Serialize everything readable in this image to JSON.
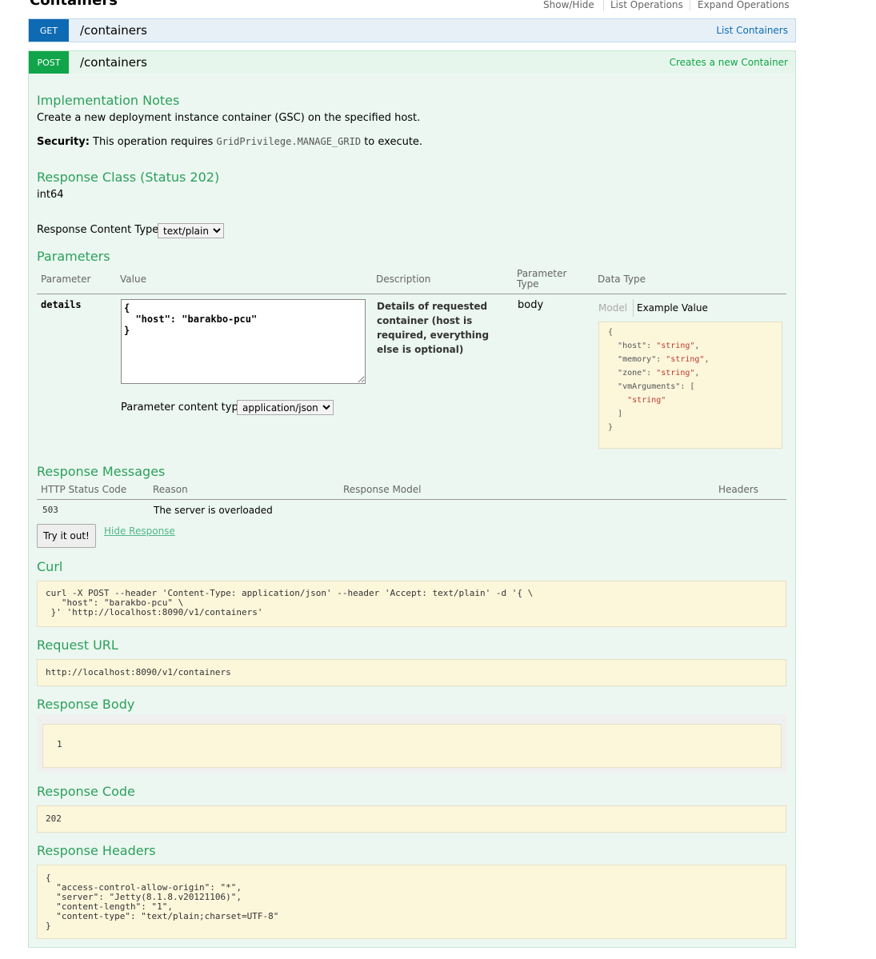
{
  "header": {
    "title": "Containers",
    "links": {
      "show_hide": "Show/Hide",
      "list_operations": "List Operations",
      "expand_operations": "Expand Operations"
    }
  },
  "get_endpoint": {
    "method": "GET",
    "path": "/containers",
    "summary": "List Containers"
  },
  "post_endpoint": {
    "method": "POST",
    "path": "/containers",
    "summary": "Creates a new Container"
  },
  "implementation_notes": {
    "heading": "Implementation Notes",
    "text": "Create a new deployment instance container (GSC) on the specified host.",
    "security_label": "Security:",
    "security_pre": "This operation requires",
    "security_code": "GridPrivilege.MANAGE_GRID",
    "security_post": "to execute."
  },
  "response_class": {
    "heading": "Response Class (Status 202)",
    "type": "int64"
  },
  "response_content_type": {
    "label": "Response Content Type",
    "selected": "text/plain"
  },
  "parameters": {
    "heading": "Parameters",
    "columns": {
      "parameter": "Parameter",
      "value": "Value",
      "description": "Description",
      "param_type_1": "Parameter",
      "param_type_2": "Type",
      "data_type": "Data Type"
    },
    "row": {
      "name": "details",
      "value": "{\n  \"host\": \"barakbo-pcu\"\n}",
      "description": "Details of requested container (host is required, everything else is optional)",
      "type": "body",
      "content_type_label": "Parameter content type:",
      "content_type_selected": "application/json",
      "model_tab": "Model",
      "example_tab": "Example Value",
      "example": {
        "open": "{",
        "host_key": "\"host\": ",
        "memory_key": "\"memory\": ",
        "zone_key": "\"zone\": ",
        "vm_key": "\"vmArguments\": [",
        "string_val": "\"string\"",
        "comma": ",",
        "close_arr": "]",
        "close": "}"
      }
    }
  },
  "response_messages": {
    "heading": "Response Messages",
    "columns": {
      "code": "HTTP Status Code",
      "reason": "Reason",
      "model": "Response Model",
      "headers": "Headers"
    },
    "row": {
      "code": "503",
      "reason": "The server is overloaded"
    }
  },
  "actions": {
    "try": "Try it out!",
    "hide": "Hide Response"
  },
  "curl": {
    "heading": "Curl",
    "text": "curl -X POST --header 'Content-Type: application/json' --header 'Accept: text/plain' -d '{ \\\n   \"host\": \"barakbo-pcu\" \\\n }' 'http://localhost:8090/v1/containers'"
  },
  "request_url": {
    "heading": "Request URL",
    "value": "http://localhost:8090/v1/containers"
  },
  "response_body": {
    "heading": "Response Body",
    "value": "1"
  },
  "response_code": {
    "heading": "Response Code",
    "value": "202"
  },
  "response_headers": {
    "heading": "Response Headers",
    "text": "{\n  \"access-control-allow-origin\": \"*\",\n  \"server\": \"Jetty(8.1.8.v20121106)\",\n  \"content-length\": \"1\",\n  \"content-type\": \"text/plain;charset=UTF-8\"\n}"
  },
  "colors": {
    "get": "#0f6ab4",
    "post": "#10a54a",
    "heading_green": "#2d9f5d",
    "code_bg": "#fcf6db"
  }
}
